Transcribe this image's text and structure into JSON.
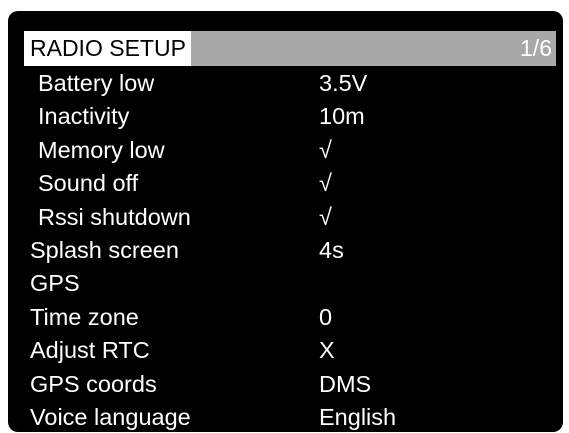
{
  "header": {
    "title": "RADIO SETUP",
    "page": "1/6"
  },
  "rows": [
    {
      "label": "Battery low",
      "value": "3.5V"
    },
    {
      "label": "Inactivity",
      "value": "10m"
    },
    {
      "label": "Memory low",
      "value": "√"
    },
    {
      "label": "Sound off",
      "value": "√"
    },
    {
      "label": "Rssi shutdown",
      "value": "√"
    },
    {
      "label": "Splash screen",
      "value": "4s"
    },
    {
      "label": "GPS",
      "value": ""
    },
    {
      "label": "Time zone",
      "value": "0"
    },
    {
      "label": "Adjust RTC",
      "value": "X"
    },
    {
      "label": "GPS coords",
      "value": "DMS"
    },
    {
      "label": "Voice language",
      "value": "English"
    }
  ],
  "colors": {
    "background": "#000000",
    "header_bar": "#a8a8a8",
    "title_highlight": "#ffffff",
    "text": "#ffffff"
  }
}
